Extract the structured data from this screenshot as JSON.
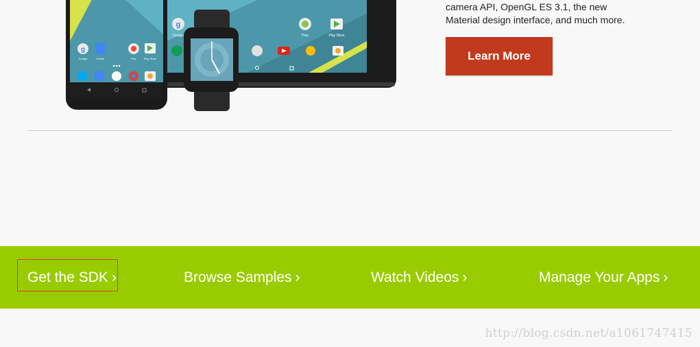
{
  "hero": {
    "description_line1": "camera API, OpenGL ES 3.1, the new",
    "description_line2": "Material design interface, and much more.",
    "cta_label": "Learn More",
    "cta_color": "#c13a1e"
  },
  "devices": {
    "phone_app_labels": [
      "Google",
      "Create",
      "Play",
      "Play Store"
    ],
    "tablet_app_labels": [
      "Google",
      "Play",
      "Play Store"
    ]
  },
  "nav_bar": {
    "color": "#99cc00",
    "links": [
      {
        "label": "Get the SDK",
        "chevron": "›"
      },
      {
        "label": "Browse Samples",
        "chevron": "›"
      },
      {
        "label": "Watch Videos",
        "chevron": "›"
      },
      {
        "label": "Manage Your Apps",
        "chevron": "›"
      }
    ]
  },
  "watermark": {
    "text": "http://blog.csdn.net/a1061747415"
  }
}
